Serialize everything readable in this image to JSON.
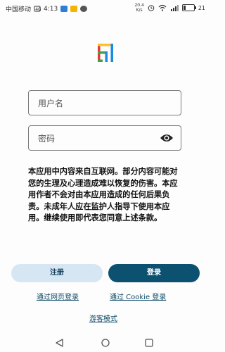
{
  "status_bar": {
    "carrier": "中国移动",
    "time": "4:13",
    "net_speed": "20.4",
    "net_speed_unit": "K/s",
    "battery": "21",
    "battery_level": 0.21,
    "icons": [
      "carrier-signal-icon",
      "sim-card-icon",
      "app-notification-icon",
      "app-notification-icon",
      "app-notification-icon",
      "alarm-icon",
      "wifi-icon",
      "signal-icon",
      "battery-icon"
    ]
  },
  "logo": {
    "icon": "app-logo-icon",
    "colors": [
      "#e53935",
      "#1e88e5",
      "#43a047",
      "#fbc02d"
    ]
  },
  "login_form": {
    "username_placeholder": "用户名",
    "password_placeholder": "密码",
    "password_toggle_icon": "eye-icon"
  },
  "disclaimer": "本应用中内容来自互联网。部分内容可能对您的生理及心理造成难以恢复的伤害。本应用作者不会对由本应用造成的任何后果负责。未成年人应在监护人指导下使用本应用。继续使用即代表您同意上述条款。",
  "actions": {
    "register_label": "注册",
    "login_label": "登录",
    "web_login_link": "通过网页登录",
    "cookie_login_link": "通过 Cookie 登录",
    "guest_link": "游客模式"
  },
  "colors": {
    "primary": "#0d5171",
    "secondary_bg": "#d6e6f3",
    "link": "#0d4a66"
  },
  "nav_bar": {
    "icons": [
      "back-icon",
      "home-icon",
      "recents-icon"
    ]
  }
}
